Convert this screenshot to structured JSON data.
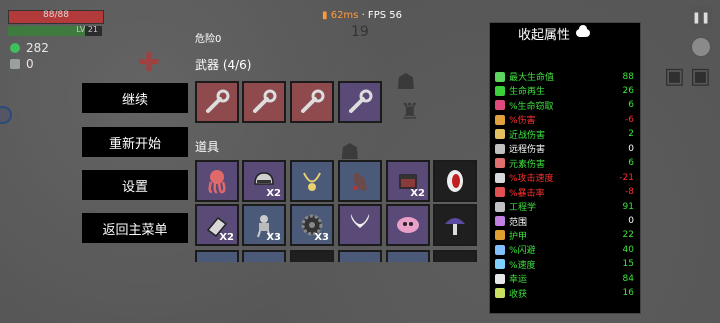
{
  "hud": {
    "hp_text": "88/88",
    "hp_fraction": 1.0,
    "level_text": "LV 21",
    "level_fraction": 0.82,
    "materials": "282",
    "bag_count": "0",
    "ping": "62ms",
    "fps": "· FPS 56",
    "timer": "19"
  },
  "menu": {
    "continue": "继续",
    "restart": "重新开始",
    "settings": "设置",
    "main_menu": "返回主菜单"
  },
  "panel": {
    "danger": "危险0",
    "weapons_title": "武器 (4/6)",
    "items_title": "道具",
    "weapons": [
      {
        "icon": "wrench-icon",
        "rarity": "red"
      },
      {
        "icon": "wrench-icon",
        "rarity": "red"
      },
      {
        "icon": "wrench-icon",
        "rarity": "red"
      },
      {
        "icon": "wrench-icon",
        "rarity": "purple"
      }
    ],
    "items_row1": [
      {
        "icon": "octopus-icon",
        "rarity": "purple",
        "count": ""
      },
      {
        "icon": "helmet-icon",
        "rarity": "purple",
        "count": "X2"
      },
      {
        "icon": "necklace-icon",
        "rarity": "blue",
        "count": ""
      },
      {
        "icon": "leech-icon",
        "rarity": "blue",
        "count": ""
      },
      {
        "icon": "box-icon",
        "rarity": "purple",
        "count": "X2"
      },
      {
        "icon": "mouth-icon",
        "rarity": "dark",
        "count": ""
      }
    ],
    "items_row2": [
      {
        "icon": "eraser-icon",
        "rarity": "purple",
        "count": "X2"
      },
      {
        "icon": "robot-icon",
        "rarity": "blue",
        "count": "X3"
      },
      {
        "icon": "gear-icon",
        "rarity": "blue",
        "count": "X3"
      },
      {
        "icon": "wings-icon",
        "rarity": "purple",
        "count": ""
      },
      {
        "icon": "blob-icon",
        "rarity": "purple",
        "count": ""
      },
      {
        "icon": "mushroom-icon",
        "rarity": "dark",
        "count": ""
      }
    ]
  },
  "stats": {
    "header": "收起属性",
    "rows": [
      {
        "name": "最大生命值",
        "value": "88",
        "color": "green",
        "icon": "heart-icon",
        "icolor": "#5fd35f"
      },
      {
        "name": "生命再生",
        "value": "26",
        "color": "green",
        "icon": "regen-heart-icon",
        "icolor": "#3ad13a"
      },
      {
        "name": "%生命窃取",
        "value": "6",
        "color": "green",
        "icon": "lifesteal-icon",
        "icolor": "#e04a7a"
      },
      {
        "name": "%伤害",
        "value": "-6",
        "color": "red",
        "icon": "damage-icon",
        "icolor": "#e0a040"
      },
      {
        "name": "近战伤害",
        "value": "2",
        "color": "green",
        "icon": "sword-icon",
        "icolor": "#e0c060"
      },
      {
        "name": "远程伤害",
        "value": "0",
        "color": "white",
        "icon": "bow-icon",
        "icolor": "#c0c0c0"
      },
      {
        "name": "元素伤害",
        "value": "6",
        "color": "green",
        "icon": "fire-icon",
        "icolor": "#e07070"
      },
      {
        "name": "%攻击速度",
        "value": "-21",
        "color": "red",
        "icon": "hourglass-icon",
        "icolor": "#d8d8d8"
      },
      {
        "name": "%暴击率",
        "value": "-8",
        "color": "red",
        "icon": "crit-icon",
        "icolor": "#e05050"
      },
      {
        "name": "工程学",
        "value": "91",
        "color": "green",
        "icon": "wrench-small-icon",
        "icolor": "#c0c0c0"
      },
      {
        "name": "范围",
        "value": "0",
        "color": "white",
        "icon": "range-icon",
        "icolor": "#c080e0"
      },
      {
        "name": "护甲",
        "value": "22",
        "color": "green",
        "icon": "shield-icon",
        "icolor": "#e0a030"
      },
      {
        "name": "%闪避",
        "value": "40",
        "color": "green",
        "icon": "dodge-icon",
        "icolor": "#80c0ff"
      },
      {
        "name": "%速度",
        "value": "15",
        "color": "green",
        "icon": "speed-icon",
        "icolor": "#80d0ff"
      },
      {
        "name": "幸运",
        "value": "84",
        "color": "green",
        "icon": "clover-icon",
        "icolor": "#e8e8e8"
      },
      {
        "name": "收获",
        "value": "16",
        "color": "green",
        "icon": "harvest-icon",
        "icolor": "#c8e060"
      }
    ]
  }
}
